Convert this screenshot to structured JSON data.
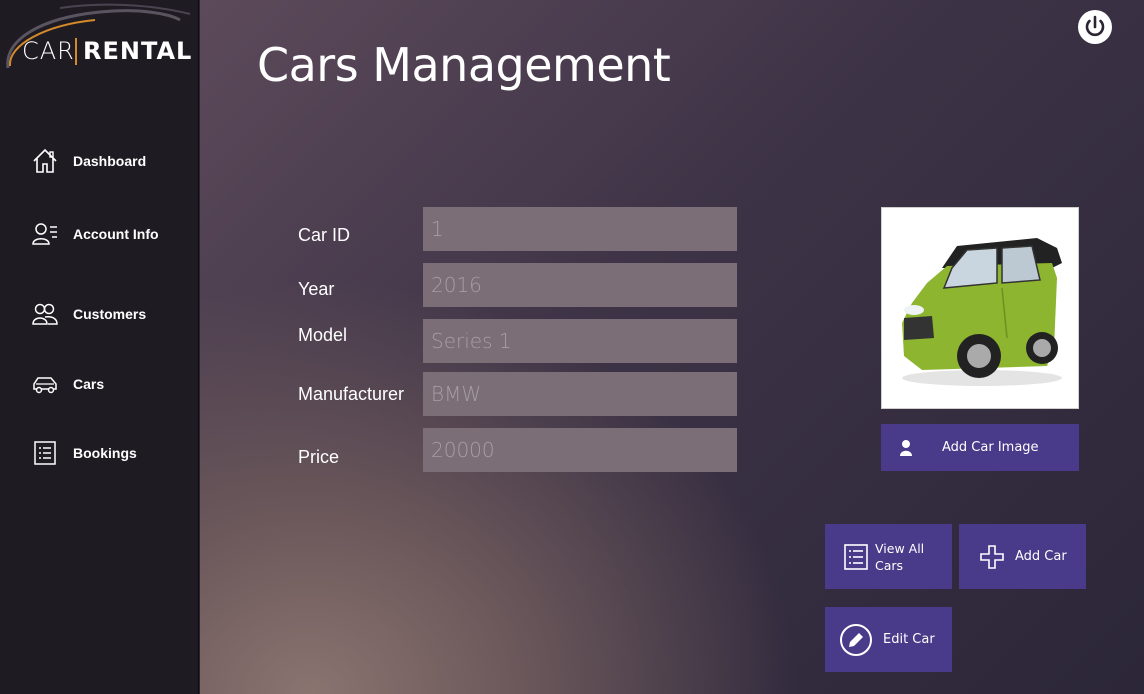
{
  "logo": {
    "left": "CAR",
    "right": "RENTAL"
  },
  "sidebar": {
    "items": [
      {
        "label": "Dashboard",
        "icon": "home-icon"
      },
      {
        "label": "Account Info",
        "icon": "user-list-icon"
      },
      {
        "label": "Customers",
        "icon": "users-icon"
      },
      {
        "label": "Cars",
        "icon": "car-icon"
      },
      {
        "label": "Bookings",
        "icon": "list-icon"
      }
    ]
  },
  "page": {
    "title": "Cars Management"
  },
  "form": {
    "fields": [
      {
        "label": "Car ID",
        "value": "1"
      },
      {
        "label": "Year",
        "value": "2016"
      },
      {
        "label": "Model",
        "value": "Series 1"
      },
      {
        "label": "Manufacturer",
        "value": "BMW"
      },
      {
        "label": "Price",
        "value": "20000"
      }
    ]
  },
  "buttons": {
    "add_image": "Add Car Image",
    "view_all_line1": "View All",
    "view_all_line2": "Cars",
    "add_car": "Add Car",
    "edit_car": "Edit Car"
  },
  "colors": {
    "sidebar_bg": "#1f1b23",
    "button_bg": "#4a3a8a",
    "field_bg": "#7b6e77",
    "logo_accent": "#d48a2a"
  }
}
